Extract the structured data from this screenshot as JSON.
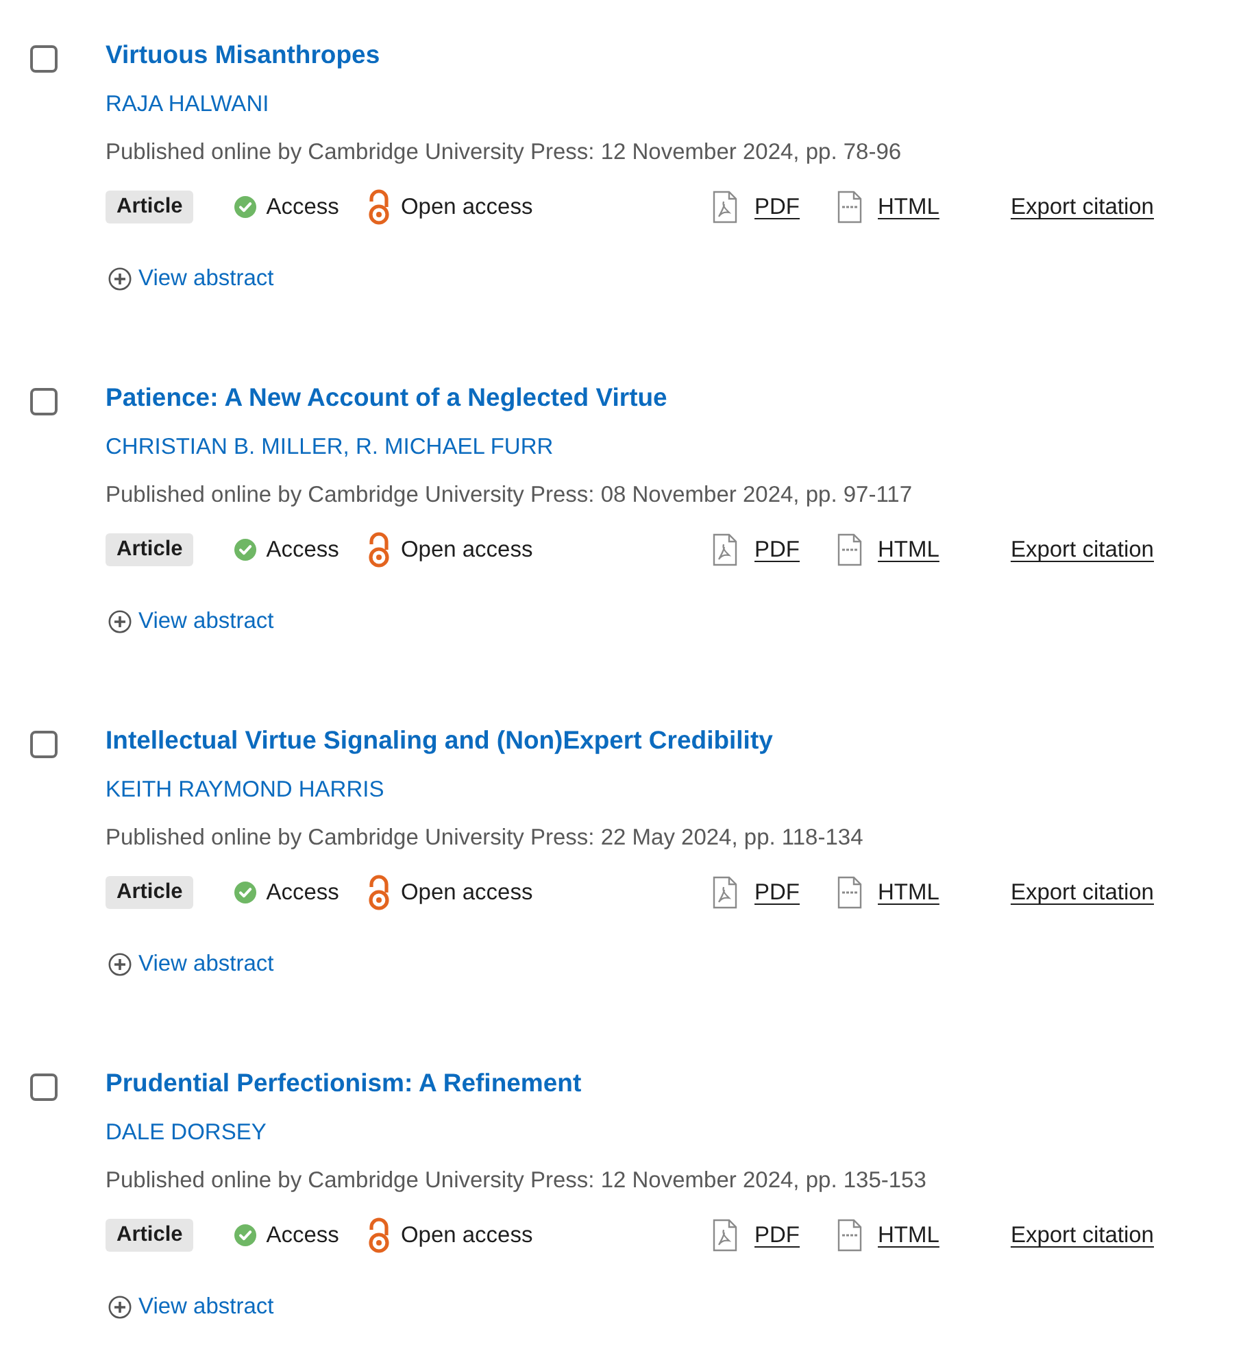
{
  "articles": [
    {
      "checked": false,
      "title": "Virtuous Misanthropes",
      "authors": "RAJA HALWANI",
      "published": "Published online by Cambridge University Press: 12 November 2024, pp. 78-96",
      "type": "Article",
      "access": "Access",
      "open_access": "Open access",
      "links": [
        {
          "kind": "pdf",
          "label": "PDF"
        },
        {
          "kind": "html",
          "label": "HTML"
        },
        {
          "kind": "export",
          "label": "Export citation"
        }
      ],
      "abstract_toggle": "View abstract"
    },
    {
      "checked": false,
      "title": "Patience: A New Account of a Neglected Virtue",
      "authors": "CHRISTIAN B. MILLER, R. MICHAEL FURR",
      "published": "Published online by Cambridge University Press: 08 November 2024, pp. 97-117",
      "type": "Article",
      "access": "Access",
      "open_access": "Open access",
      "links": [
        {
          "kind": "pdf",
          "label": "PDF"
        },
        {
          "kind": "html",
          "label": "HTML"
        },
        {
          "kind": "export",
          "label": "Export citation"
        }
      ],
      "abstract_toggle": "View abstract"
    },
    {
      "checked": false,
      "title": "Intellectual Virtue Signaling and (Non)Expert Credibility",
      "authors": "KEITH RAYMOND HARRIS",
      "published": "Published online by Cambridge University Press: 22 May 2024, pp. 118-134",
      "type": "Article",
      "access": "Access",
      "open_access": "Open access",
      "links": [
        {
          "kind": "pdf",
          "label": "PDF"
        },
        {
          "kind": "html",
          "label": "HTML"
        },
        {
          "kind": "export",
          "label": "Export citation"
        }
      ],
      "abstract_toggle": "View abstract"
    },
    {
      "checked": false,
      "title": "Prudential Perfectionism: A Refinement",
      "authors": "DALE DORSEY",
      "published": "Published online by Cambridge University Press: 12 November 2024, pp. 135-153",
      "type": "Article",
      "access": "Access",
      "open_access": "Open access",
      "links": [
        {
          "kind": "pdf",
          "label": "PDF"
        },
        {
          "kind": "html",
          "label": "HTML"
        },
        {
          "kind": "export",
          "label": "Export citation"
        }
      ],
      "abstract_toggle": "View abstract"
    }
  ]
}
